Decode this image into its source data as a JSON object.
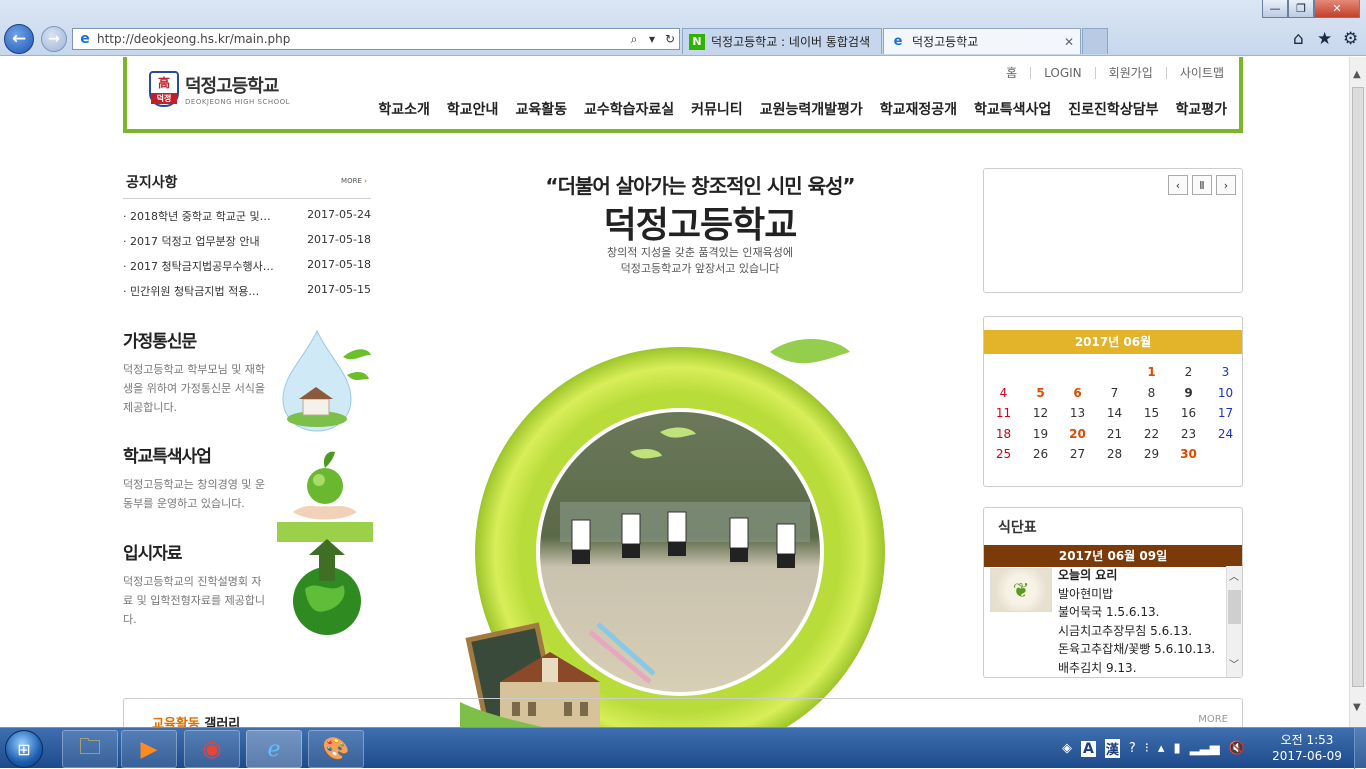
{
  "browser": {
    "url": "http://deokjeong.hs.kr/main.php",
    "tabs": [
      {
        "label": "덕정고등학교 : 네이버 통합검색"
      },
      {
        "label": "덕정고등학교"
      }
    ],
    "back_glyph": "←",
    "forward_glyph": "→",
    "window_controls": {
      "minimize": "—",
      "maximize": "❐",
      "close": "✕"
    }
  },
  "site": {
    "logo_emblem": "高",
    "logo_emblem_sub": "덕정",
    "logo_name": "덕정고등학교",
    "logo_english": "DEOKJEONG HIGH SCHOOL",
    "util_nav": [
      "홈",
      "LOGIN",
      "회원가입",
      "사이트맵"
    ],
    "main_nav": [
      "학교소개",
      "학교안내",
      "교육활동",
      "교수학습자료실",
      "커뮤니티",
      "교원능력개발평가",
      "학교재정공개",
      "학교특색사업",
      "진로진학상담부",
      "학교평가"
    ]
  },
  "notice": {
    "title": "공지사항",
    "more": "MORE",
    "items": [
      {
        "title": "2018학년 중학교 학교군 및…",
        "date": "2017-05-24"
      },
      {
        "title": "2017 덕정고 업무분장 안내",
        "date": "2017-05-18"
      },
      {
        "title": "2017 청탁금지법공무수행사…",
        "date": "2017-05-18"
      },
      {
        "title": "민간위원 청탁금지법 적용…",
        "date": "2017-05-15"
      }
    ]
  },
  "promos": [
    {
      "title": "가정통신문",
      "desc": "덕정고등학교 학부모님 및 재학생을 위하여 가정통신문 서식을 제공합니다."
    },
    {
      "title": "학교특색사업",
      "desc": "덕정고등학교는 창의경영 및 운동부를 운영하고 있습니다."
    },
    {
      "title": "입시자료",
      "desc": "덕정고등학교의 진학설명회 자료 및 입학전형자료를 제공합니다."
    }
  ],
  "visual": {
    "slogan": "“더불어 살아가는 창조적인 시민 육성”",
    "school_name": "덕정고등학교",
    "sub_line1": "창의적 지성을 갖춘 품격있는 인재육성에",
    "sub_line2": "덕정고등학교가 앞장서고 있습니다"
  },
  "popup_controls": {
    "prev": "‹",
    "pause": "Ⅱ",
    "next": "›"
  },
  "calendar": {
    "title": "2017년 06월",
    "weeks": [
      [
        "",
        "",
        "",
        "",
        "1",
        "2",
        "3"
      ],
      [
        "4",
        "5",
        "6",
        "7",
        "8",
        "9",
        "10"
      ],
      [
        "11",
        "12",
        "13",
        "14",
        "15",
        "16",
        "17"
      ],
      [
        "18",
        "19",
        "20",
        "21",
        "22",
        "23",
        "24"
      ],
      [
        "25",
        "26",
        "27",
        "28",
        "29",
        "30",
        ""
      ]
    ],
    "holidays": [
      "1",
      "5",
      "6",
      "20",
      "30"
    ],
    "today": "9"
  },
  "meal": {
    "title": "식단표",
    "date": "2017년 06월 09일",
    "heading": "오늘의 요리",
    "items": [
      "발아현미밥",
      "불어묵국 1.5.6.13.",
      "시금치고추장무침 5.6.13.",
      "돈육고추잡채/꽃빵 5.6.10.13.",
      "배추김치 9.13."
    ]
  },
  "gallery": {
    "title_accent": "교육활동",
    "title": "갤러리",
    "more": "MORE"
  },
  "taskbar": {
    "tray_ime_a": "A",
    "tray_ime_han": "漢",
    "clock_time": "오전 1:53",
    "clock_date": "2017-06-09"
  }
}
